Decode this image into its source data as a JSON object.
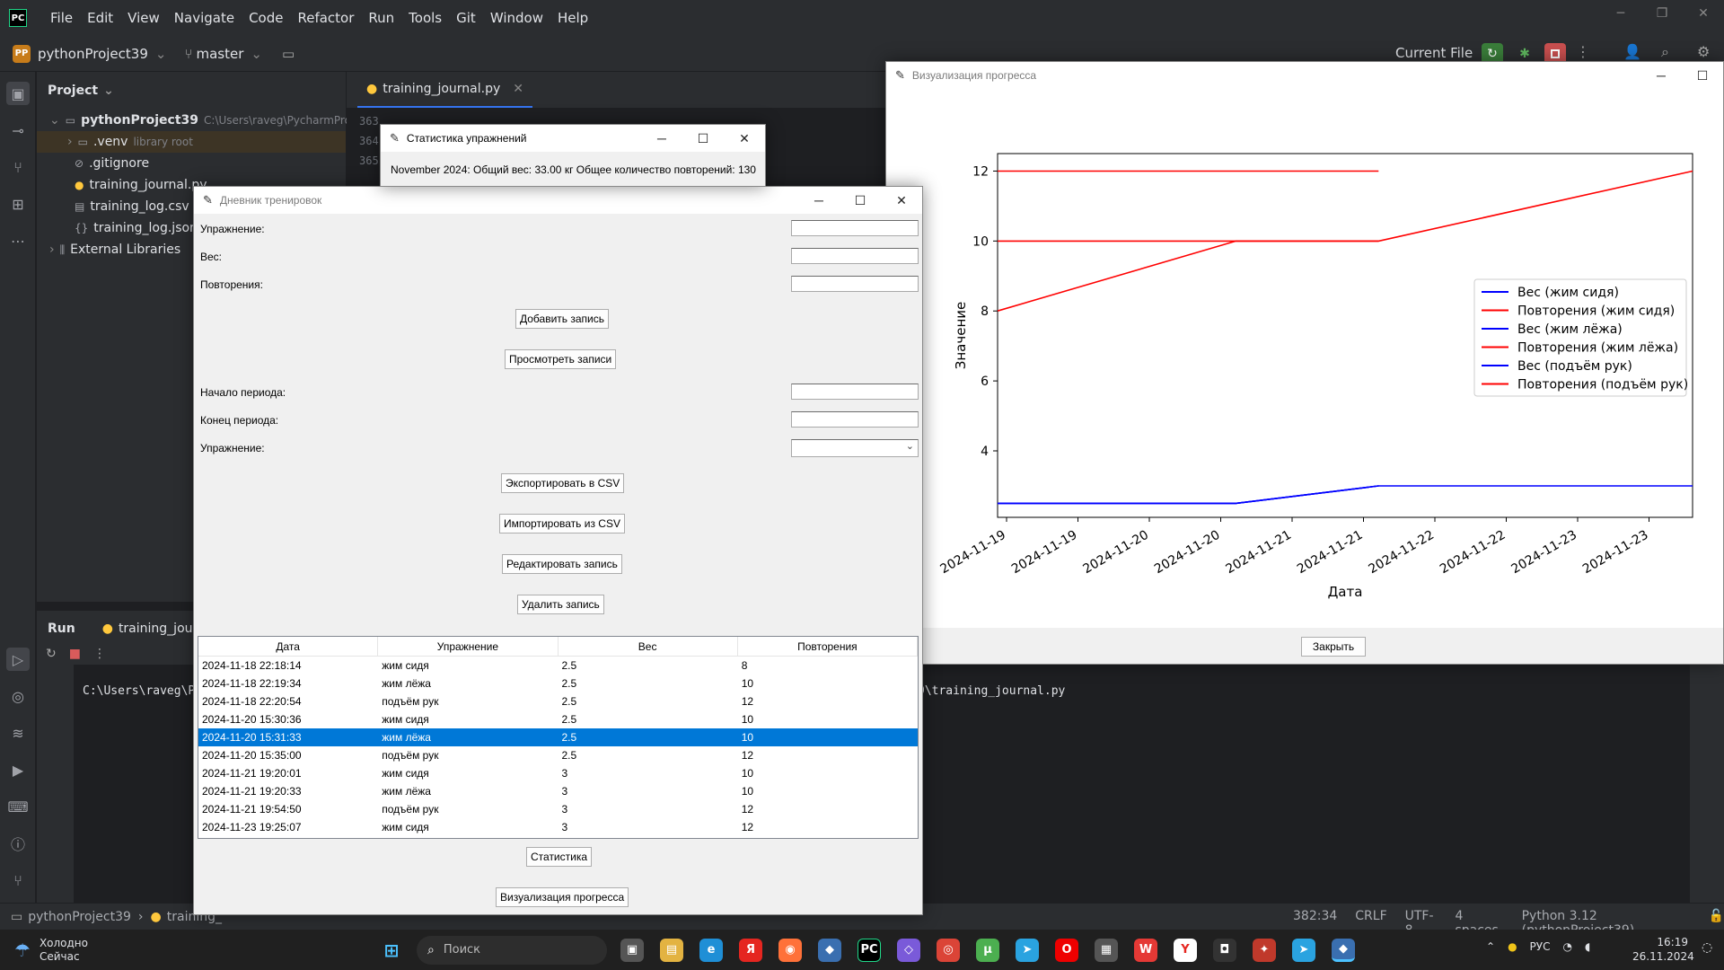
{
  "ide": {
    "logo": "PC",
    "menu": [
      "File",
      "Edit",
      "View",
      "Navigate",
      "Code",
      "Refactor",
      "Run",
      "Tools",
      "Git",
      "Window",
      "Help"
    ],
    "project_badge": "PP",
    "project_name": "pythonProject39",
    "branch": "master",
    "current_file": "Current File",
    "project_panel_title": "Project",
    "tree": [
      {
        "label": "pythonProject39",
        "extra": "C:\\Users\\raveg\\PycharmProje",
        "icon": "folder-icon"
      },
      {
        "label": ".venv",
        "extra": "library root",
        "icon": "folder-icon"
      },
      {
        "label": ".gitignore",
        "extra": "",
        "icon": "ignore-icon"
      },
      {
        "label": "training_journal.py",
        "extra": "",
        "icon": "python-icon"
      },
      {
        "label": "training_log.csv",
        "extra": "",
        "icon": "file-icon"
      },
      {
        "label": "training_log.json",
        "extra": "",
        "icon": "json-icon"
      },
      {
        "label": "External Libraries",
        "extra": "",
        "icon": "library-icon"
      }
    ],
    "editor_tab": "training_journal.py",
    "line_numbers": [
      "363",
      "364",
      "365"
    ],
    "run_label": "Run",
    "run_tab": "training_journa",
    "console_left": "C:\\Users\\raveg\\P",
    "console_right": "9\\training_journal.py",
    "status": {
      "breadcrumb_project": "pythonProject39",
      "breadcrumb_file": "training_",
      "position": "382:34",
      "line_sep": "CRLF",
      "encoding": "UTF-8",
      "indent": "4 spaces",
      "interpreter": "Python 3.12 (pythonProject39)"
    }
  },
  "stats_window": {
    "title": "Статистика упражнений",
    "message": "November 2024: Общий вес: 33.00 кг Общее количество повторений: 130"
  },
  "journal_window": {
    "title": "Дневник тренировок",
    "labels": {
      "exercise": "Упражнение:",
      "weight": "Вес:",
      "reps": "Повторения:",
      "start": "Начало периода:",
      "end": "Конец периода:",
      "exercise_filter": "Упражнение:"
    },
    "buttons": {
      "add": "Добавить запись",
      "view": "Просмотреть записи",
      "export": "Экспортировать в CSV",
      "import": "Импортировать из CSV",
      "edit": "Редактировать запись",
      "delete": "Удалить запись",
      "stats": "Статистика",
      "visualize": "Визуализация прогресса"
    },
    "columns": [
      "Дата",
      "Упражнение",
      "Вес",
      "Повторения"
    ],
    "rows": [
      [
        "2024-11-18 22:18:14",
        "жим сидя",
        "2.5",
        "8"
      ],
      [
        "2024-11-18 22:19:34",
        "жим лёжа",
        "2.5",
        "10"
      ],
      [
        "2024-11-18 22:20:54",
        "подъём рук",
        "2.5",
        "12"
      ],
      [
        "2024-11-20 15:30:36",
        "жим сидя",
        "2.5",
        "10"
      ],
      [
        "2024-11-20 15:31:33",
        "жим лёжа",
        "2.5",
        "10"
      ],
      [
        "2024-11-20 15:35:00",
        "подъём рук",
        "2.5",
        "12"
      ],
      [
        "2024-11-21 19:20:01",
        "жим сидя",
        "3",
        "10"
      ],
      [
        "2024-11-21 19:20:33",
        "жим лёжа",
        "3",
        "10"
      ],
      [
        "2024-11-21 19:54:50",
        "подъём рук",
        "3",
        "12"
      ],
      [
        "2024-11-23 19:25:07",
        "жим сидя",
        "3",
        "12"
      ]
    ],
    "selected_row": 4
  },
  "viz_window": {
    "title": "Визуализация прогресса",
    "close_button": "Закрыть"
  },
  "chart_data": {
    "type": "line",
    "xlabel": "Дата",
    "ylabel": "Значение",
    "x_tick_labels": [
      "2024-11-19",
      "2024-11-19",
      "2024-11-20",
      "2024-11-20",
      "2024-11-21",
      "2024-11-21",
      "2024-11-22",
      "2024-11-22",
      "2024-11-23",
      "2024-11-23"
    ],
    "y_ticks": [
      4,
      6,
      8,
      10,
      12
    ],
    "xlim": [
      "2024-11-18",
      "2024-11-23"
    ],
    "ylim": [
      2.1,
      12.5
    ],
    "legend_position": "center-right",
    "series": [
      {
        "name": "Вес (жим сидя)",
        "color": "#0000ff",
        "x": [
          "2024-11-18",
          "2024-11-20",
          "2024-11-21",
          "2024-11-23"
        ],
        "y": [
          2.5,
          2.5,
          3,
          3
        ]
      },
      {
        "name": "Повторения (жим сидя)",
        "color": "#ff0000",
        "x": [
          "2024-11-18",
          "2024-11-20",
          "2024-11-21",
          "2024-11-23"
        ],
        "y": [
          8,
          10,
          10,
          12
        ]
      },
      {
        "name": "Вес (жим лёжа)",
        "color": "#0000ff",
        "x": [
          "2024-11-18",
          "2024-11-20",
          "2024-11-21"
        ],
        "y": [
          2.5,
          2.5,
          3
        ]
      },
      {
        "name": "Повторения (жим лёжа)",
        "color": "#ff0000",
        "x": [
          "2024-11-18",
          "2024-11-20",
          "2024-11-21"
        ],
        "y": [
          10,
          10,
          10
        ]
      },
      {
        "name": "Вес (подъём рук)",
        "color": "#0000ff",
        "x": [
          "2024-11-18",
          "2024-11-20",
          "2024-11-21"
        ],
        "y": [
          2.5,
          2.5,
          3
        ]
      },
      {
        "name": "Повторения (подъём рук)",
        "color": "#ff0000",
        "x": [
          "2024-11-18",
          "2024-11-20",
          "2024-11-21"
        ],
        "y": [
          12,
          12,
          12
        ]
      }
    ]
  },
  "taskbar": {
    "weather_title": "Холодно",
    "weather_sub": "Сейчас",
    "search_placeholder": "Поиск",
    "lang": "РУС",
    "time": "16:19",
    "date": "26.11.2024"
  }
}
